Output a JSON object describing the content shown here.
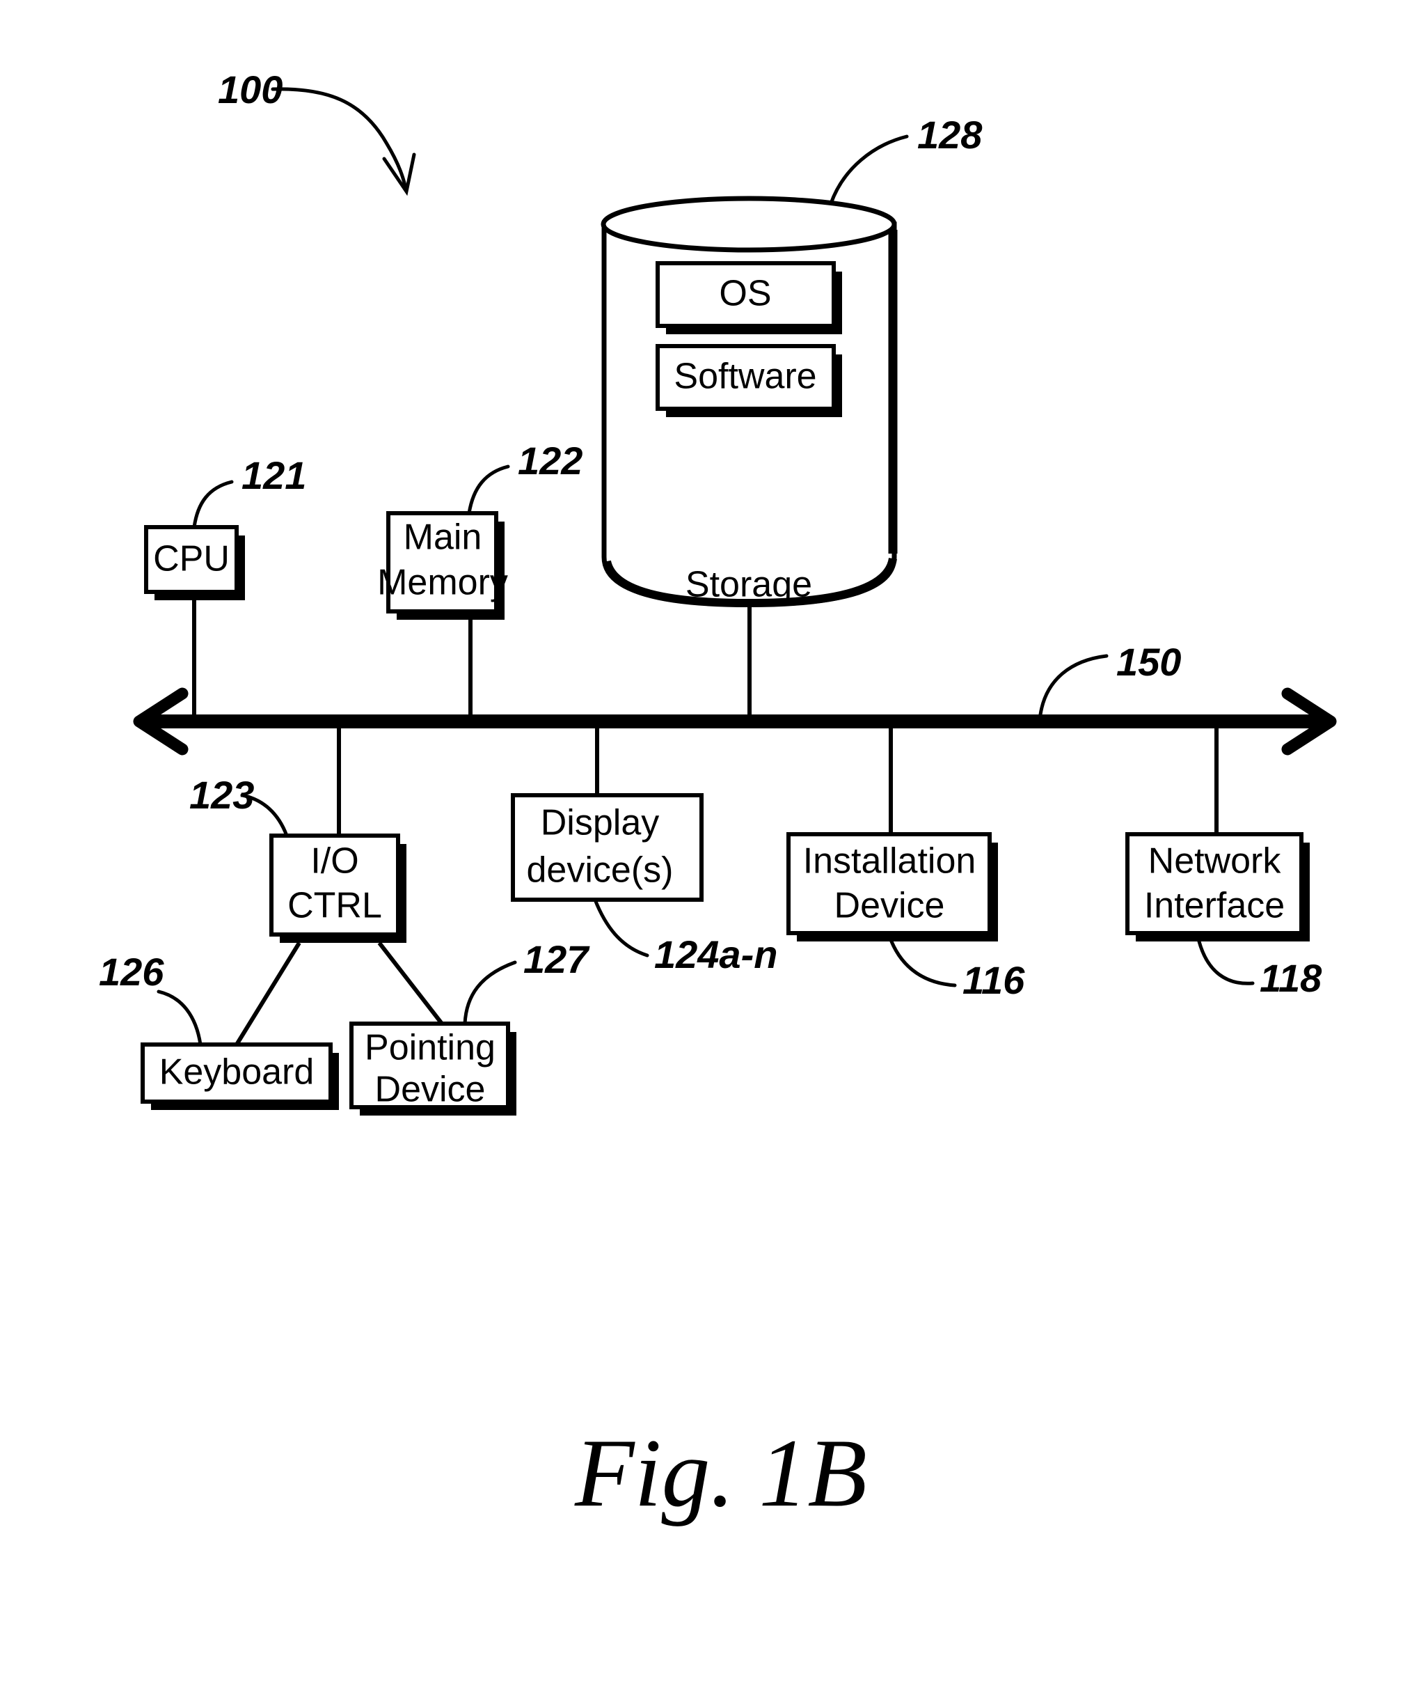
{
  "figure": {
    "caption": "Fig. 1B",
    "system_ref": "100"
  },
  "nodes": {
    "cpu": {
      "label": "CPU",
      "ref": "121"
    },
    "main_memory": {
      "label_line1": "Main",
      "label_line2": "Memory",
      "ref": "122"
    },
    "storage": {
      "label": "Storage",
      "ref": "128"
    },
    "os": {
      "label": "OS"
    },
    "software": {
      "label": "Software"
    },
    "bus": {
      "ref": "150"
    },
    "io_ctrl": {
      "label_line1": "I/O",
      "label_line2": "CTRL",
      "ref": "123"
    },
    "display": {
      "label_line1": "Display",
      "label_line2": "device(s)",
      "ref": "124a-n"
    },
    "installation": {
      "label_line1": "Installation",
      "label_line2": "Device",
      "ref": "116"
    },
    "network": {
      "label_line1": "Network",
      "label_line2": "Interface",
      "ref": "118"
    },
    "keyboard": {
      "label": "Keyboard",
      "ref": "126"
    },
    "pointing": {
      "label_line1": "Pointing",
      "label_line2": "Device",
      "ref": "127"
    }
  },
  "colors": {
    "ink": "#000000",
    "paper": "#ffffff"
  }
}
